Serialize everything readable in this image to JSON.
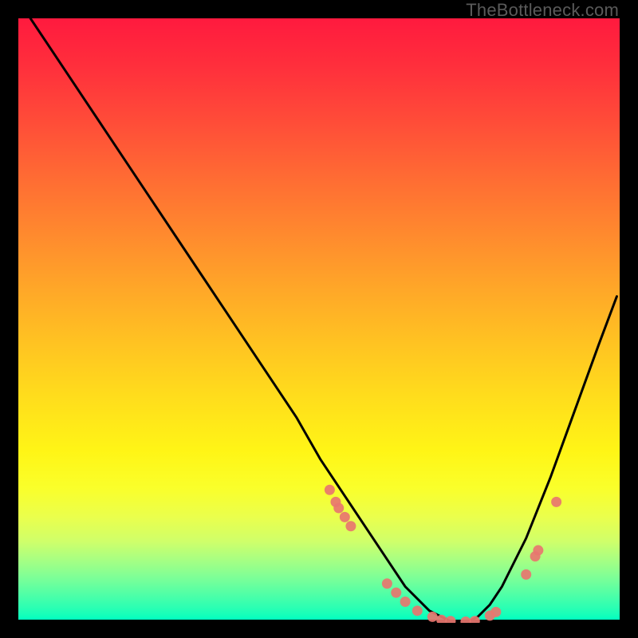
{
  "watermark": "TheBottleneck.com",
  "chart_data": {
    "type": "line",
    "title": "",
    "xlabel": "",
    "ylabel": "",
    "xlim": [
      0,
      100
    ],
    "ylim": [
      0,
      100
    ],
    "x": [
      2,
      6,
      10,
      14,
      18,
      22,
      26,
      30,
      34,
      38,
      42,
      46,
      50,
      52,
      54,
      56,
      58,
      60,
      62,
      64,
      66,
      68,
      70,
      72,
      74,
      76,
      78,
      80,
      84,
      88,
      92,
      96,
      99
    ],
    "y": [
      100,
      94,
      88,
      82,
      76,
      70,
      64,
      58,
      52,
      46,
      40,
      34,
      27,
      24,
      21,
      18,
      15,
      12,
      9,
      6,
      4,
      2,
      1,
      0,
      0,
      1,
      3,
      6,
      14,
      24,
      35,
      46,
      54
    ],
    "marker_points": {
      "x": [
        51.5,
        52.5,
        53,
        54,
        55,
        61,
        62.5,
        64,
        66,
        68.5,
        70,
        71.5,
        74,
        75.5,
        78,
        79,
        84,
        85.5,
        86,
        89
      ],
      "y": [
        22,
        20,
        19,
        17.5,
        16,
        6.5,
        5,
        3.5,
        2,
        1,
        0.5,
        0.3,
        0.2,
        0.3,
        1.2,
        1.8,
        8,
        11,
        12,
        20
      ]
    },
    "colors": {
      "curve": "#000000",
      "markers": "#e8766f",
      "gradient_top": "#ff1a3e",
      "gradient_bottom": "#00ffc0"
    }
  }
}
